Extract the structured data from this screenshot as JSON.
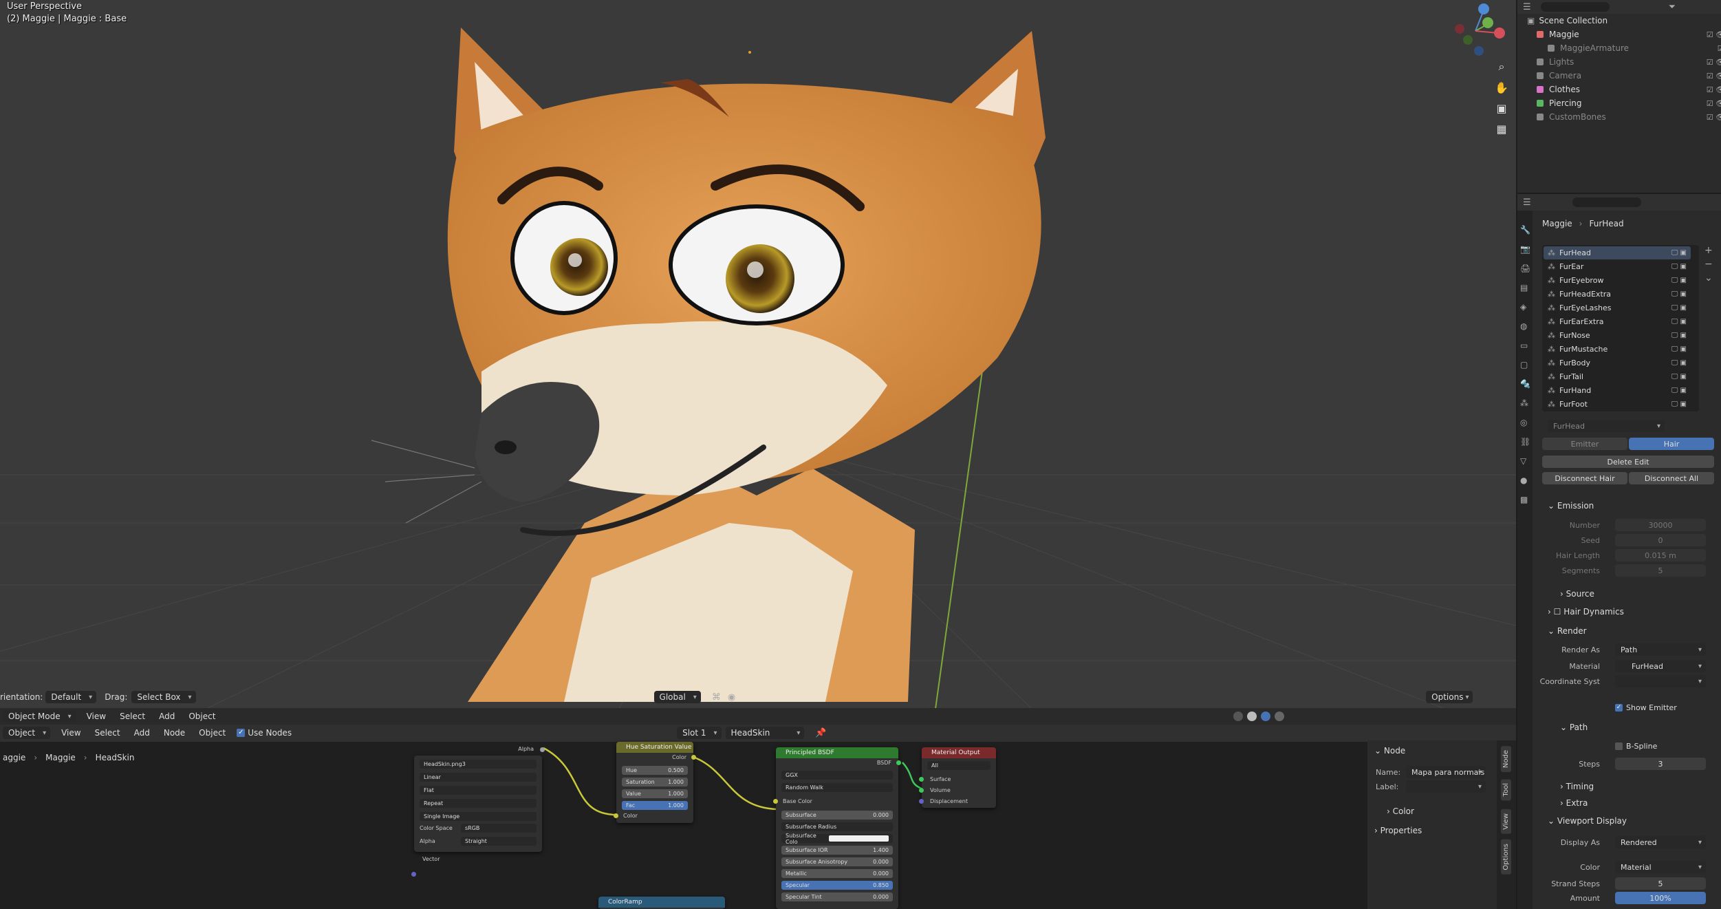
{
  "viewport": {
    "title": "User Perspective",
    "subtitle": "(2) Maggie | Maggie : Base",
    "gizmo_axes": [
      "Z",
      "Y",
      "X"
    ],
    "icons": [
      "zoom-icon",
      "hand-icon",
      "camera-icon",
      "grid-icon"
    ]
  },
  "viewport_header": {
    "orientation_label": "rientation:",
    "orientation_value": "Default",
    "drag_label": "Drag:",
    "drag_value": "Select Box",
    "transform_value": "Global",
    "options_label": "Options"
  },
  "node_header": {
    "mode": "Object Mode",
    "editor_type": "Object",
    "menus": [
      "View",
      "Select",
      "Add",
      "Node",
      "Object"
    ],
    "use_nodes_label": "Use Nodes",
    "slot": "Slot 1",
    "material": "HeadSkin",
    "breadcrumb": [
      "aggie",
      "Maggie",
      "HeadSkin"
    ]
  },
  "nodes": {
    "image": {
      "file": "HeadSkin.png",
      "users": "3",
      "alpha_out": "Alpha",
      "interpolation": "Linear",
      "projection": "Flat",
      "extension": "Repeat",
      "source": "Single Image",
      "color_space_label": "Color Space",
      "color_space": "sRGB",
      "alpha_label": "Alpha",
      "alpha_mode": "Straight",
      "vector": "Vector"
    },
    "hsv": {
      "title": "Hue Saturation Value",
      "out": "Color",
      "fields": [
        {
          "label": "Hue",
          "value": "0.500"
        },
        {
          "label": "Saturation",
          "value": "1.000"
        },
        {
          "label": "Value",
          "value": "1.000"
        },
        {
          "label": "Fac",
          "value": "1.000"
        }
      ],
      "in_color": "Color"
    },
    "bsdf": {
      "title": "Principled BSDF",
      "out": "BSDF",
      "distribution": "GGX",
      "subsurface_method": "Random Walk",
      "base_color": "Base Color",
      "fields": [
        {
          "label": "Subsurface",
          "value": "0.000"
        },
        {
          "label": "Subsurface Radius",
          "value": ""
        },
        {
          "label": "Subsurface Colo",
          "value": ""
        },
        {
          "label": "Subsurface IOR",
          "value": "1.400"
        },
        {
          "label": "Subsurface Anisotropy",
          "value": "0.000"
        },
        {
          "label": "Metallic",
          "value": "0.000"
        },
        {
          "label": "Specular",
          "value": "0.850"
        },
        {
          "label": "Specular Tint",
          "value": "0.000"
        }
      ]
    },
    "output": {
      "title": "Material Output",
      "target": "All",
      "inputs": [
        "Surface",
        "Volume",
        "Displacement"
      ]
    },
    "colorramp": {
      "title": "ColorRamp"
    }
  },
  "npanel": {
    "node_header": "Node",
    "name_label": "Name:",
    "name_value": "Mapa para normais",
    "label_label": "Label:",
    "color_label": "Color",
    "properties_label": "Properties",
    "tabs": [
      "Node",
      "Tool",
      "View",
      "Options"
    ]
  },
  "outliner": {
    "root": "Scene Collection",
    "items": [
      {
        "label": "Maggie",
        "dim": false,
        "color": "#e06a6a"
      },
      {
        "label": "MaggieArmature",
        "dim": true,
        "color": "#888888"
      },
      {
        "label": "Lights",
        "dim": true,
        "color": "#888888"
      },
      {
        "label": "Camera",
        "dim": true,
        "color": "#888888"
      },
      {
        "label": "Clothes",
        "dim": false,
        "color": "#d873c8"
      },
      {
        "label": "Piercing",
        "dim": false,
        "color": "#59b85f"
      },
      {
        "label": "CustomBones",
        "dim": true,
        "color": "#888888"
      }
    ]
  },
  "properties": {
    "breadcrumb": [
      "Maggie",
      "FurHead"
    ],
    "particle_systems": [
      "FurHead",
      "FurEar",
      "FurEyebrow",
      "FurHeadExtra",
      "FurEyeLashes",
      "FurEarExtra",
      "FurNose",
      "FurMustache",
      "FurBody",
      "FurTail",
      "FurHand",
      "FurFoot"
    ],
    "settings_name": "FurHead",
    "type_tabs": [
      "Emitter",
      "Hair"
    ],
    "delete_edit": "Delete Edit",
    "disconnect_hair": "Disconnect Hair",
    "disconnect_all": "Disconnect All",
    "emission": {
      "title": "Emission",
      "rows": [
        {
          "label": "Number",
          "value": "30000"
        },
        {
          "label": "Seed",
          "value": "0"
        },
        {
          "label": "Hair Length",
          "value": "0.015 m"
        },
        {
          "label": "Segments",
          "value": "5"
        }
      ],
      "source": "Source"
    },
    "hair_dynamics": "Hair Dynamics",
    "render": {
      "title": "Render",
      "render_as_label": "Render As",
      "render_as": "Path",
      "material_label": "Material",
      "material": "FurHead",
      "coord_label": "Coordinate Syst",
      "show_emitter": "Show Emitter",
      "path": "Path",
      "bspline": "B-Spline",
      "steps_label": "Steps",
      "steps": "3",
      "timing": "Timing",
      "extra": "Extra"
    },
    "viewport_display": {
      "title": "Viewport Display",
      "display_as_label": "Display As",
      "display_as": "Rendered",
      "color_label": "Color",
      "color": "Material",
      "strand_steps_label": "Strand Steps",
      "strand_steps": "5",
      "amount_label": "Amount",
      "amount": "100%"
    }
  }
}
